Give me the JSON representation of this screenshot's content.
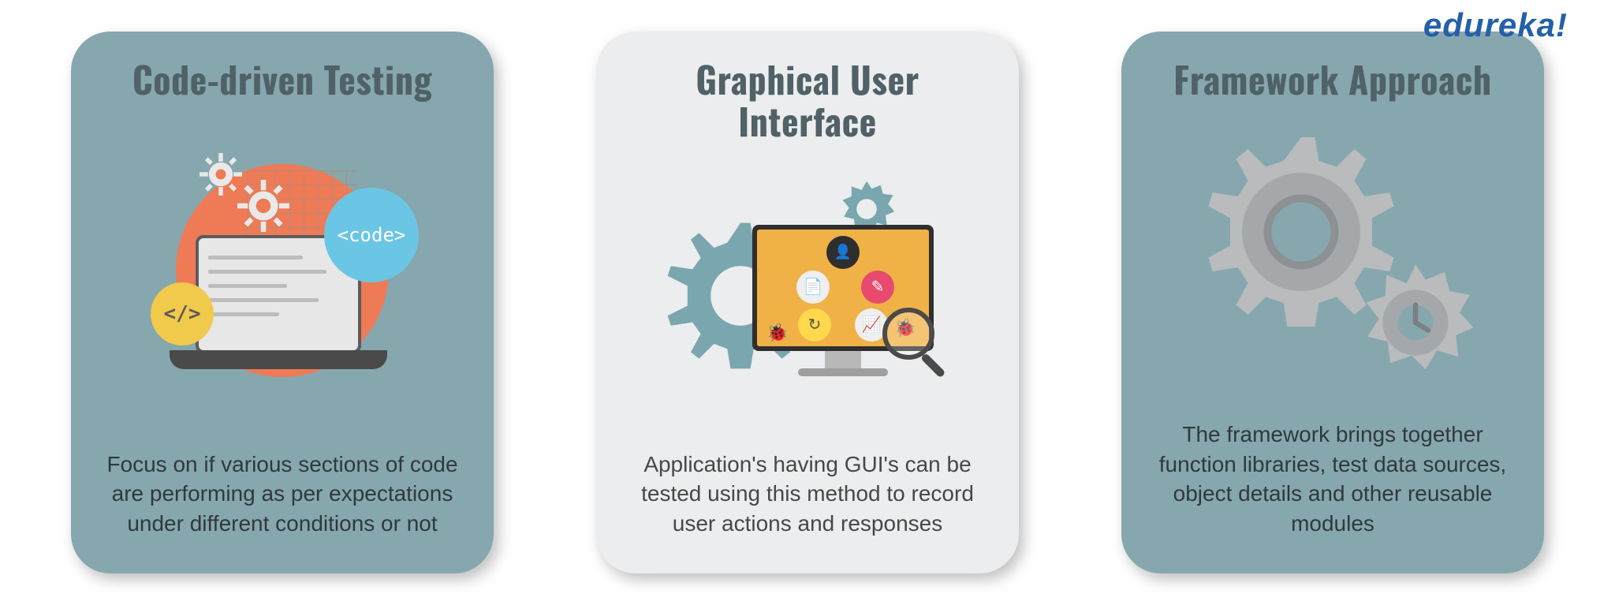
{
  "brand": "edureka!",
  "cards": [
    {
      "title": "Code-driven Testing",
      "desc": "Focus on if various sections of code are performing as per expectations under different conditions or not",
      "code_bubble": "<code>",
      "tag_bubble": "</>"
    },
    {
      "title": "Graphical User Interface",
      "desc": "Application's having GUI's can be tested using this method to record user actions and responses"
    },
    {
      "title": "Framework Approach",
      "desc": "The framework brings together function libraries, test data sources, object details and other reusable modules"
    }
  ],
  "colors": {
    "teal_card": "#86a7ae",
    "grey_card": "#ecedee",
    "brand": "#2460a8"
  }
}
